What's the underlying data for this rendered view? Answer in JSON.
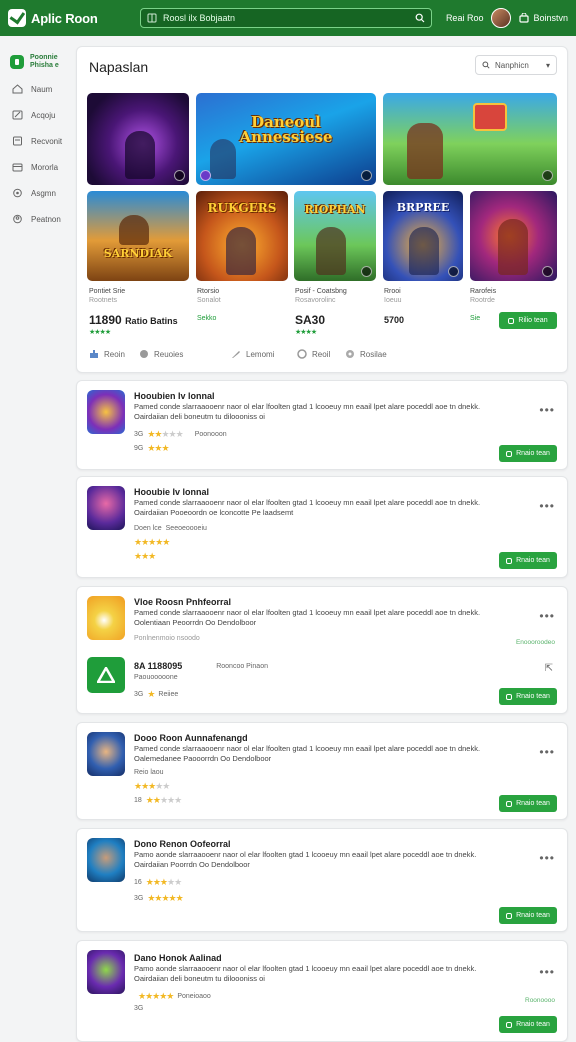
{
  "header": {
    "app_name": "Aplic Roon",
    "search_value": "Roosl ilx Bobjaatn",
    "link1": "Reai Roo",
    "cart_label": "Boinstvn"
  },
  "sidebar": {
    "brand_line1": "Poonnie",
    "brand_line2": "Phisha e",
    "items": [
      {
        "label": "Naum",
        "icon": "home-icon"
      },
      {
        "label": "Acqoju",
        "icon": "pencil-icon"
      },
      {
        "label": "Recvonit",
        "icon": "document-icon"
      },
      {
        "label": "Mororla",
        "icon": "calendar-icon"
      },
      {
        "label": "Asgmn",
        "icon": "settings-icon"
      },
      {
        "label": "Peatnon",
        "icon": "user-icon"
      }
    ]
  },
  "featured": {
    "title": "Napaslan",
    "sort_label": "Nanphicn",
    "tiles": [
      {
        "title": ""
      },
      {
        "title": "Daneoul\nAnnessiese"
      },
      {
        "title": ""
      },
      {
        "title": "SARNDIAK"
      },
      {
        "title": "RUKGERS"
      },
      {
        "title": "RIOPHAN"
      },
      {
        "title": "BRPREE"
      },
      {
        "title": ""
      }
    ],
    "games": [
      {
        "name": "Pontiet Srie",
        "sub": "Rootnets",
        "price": "11890",
        "price_note": "Ratio Batins",
        "rating": "★★★★"
      },
      {
        "name": "Rtorsio",
        "sub": "Sonalot",
        "price": "",
        "price_note": "",
        "rating": "Sekko"
      },
      {
        "name": "Posif - Coatsbng",
        "sub": "Rosavorolinc",
        "price": "SA30",
        "price_note": "",
        "rating": "★★★★"
      },
      {
        "name": "Rrooi",
        "sub": "Ioeuu",
        "price": "5700",
        "price_note": "",
        "rating": ""
      },
      {
        "name": "Rarofeis",
        "sub": "Rootrde",
        "price": "",
        "price_note": "",
        "rating": "Sie"
      }
    ],
    "get_label": "Rilio tean",
    "tags": [
      "Reoin",
      "Reuoies",
      "Lemomi",
      "Reoil",
      "Rosilae"
    ]
  },
  "apps": [
    {
      "name": "Hooubien Iv lonnal",
      "desc": "Pamed conde slarraaooenr naor ol elar lfoolten gtad 1 lcooeuy mn eaail lpet alare poceddl aoe  tn dnekk. Oairdaiian deli boneutm tu diloooniss oi",
      "meta1": "3G",
      "meta1b": "Poonooon",
      "meta2": "9G",
      "rating1": 2,
      "rating2": 3,
      "button": "Rnaio tean"
    },
    {
      "name": "Hooubie Iv lonnal",
      "desc": "Pamed conde slarraaooenr naor ol elar lfoolten gtad 1 lcooeuy mn eaail lpet alare poceddl aoe  tn dnekk. Oairdaiian Pooeoordn oe lconcotte Pe laadsemt",
      "meta1": "Doen lce",
      "meta1b": "Seeoeoooeiu",
      "meta2": "",
      "rating1": 5,
      "rating2": 3,
      "button": "Rnaio tean"
    },
    {
      "name": "Vloe Roosn Pnhfeorral",
      "desc": "Pamed conde slarraaooenr naor ol elar lfoolten gtad 1 lcooeuy mn eaail lpet alare poceddl aoe  tn dnekk. Oolentiaan Peoorrdn Oo Dendolboor",
      "meta1": "Ponlnenmoio nsoodo",
      "side_note": "Enoooroodeo",
      "price": "8A 1188095",
      "price_note": "Rooncoo Pinaon",
      "sub": "Paouooooone",
      "meta2": "3G",
      "meta2b": "Reiiee",
      "rating1": 0,
      "rating2": 1,
      "button": "Rnaio tean"
    },
    {
      "name": "Dooo Roon Aunnafenangd",
      "desc": "Pamed conde slarraaooenr naor ol elar lfoolten gtad 1 lcooeuy mn eaail lpet alare poceddl aoe  tn dnekk. Oalemedanee Paooorrdn Oo Dendolboor",
      "meta1": "Reio laou",
      "meta2": "18",
      "rating1": 3,
      "rating2": 2,
      "button": "Rnaio tean"
    },
    {
      "name": "Dono Renon Oofeorral",
      "desc": "Pamo aonde slarraaooenr naor ol elar lfoolten gtad 1 lcooeuy mn eaail lpet alare poceddl aoe  tn dnekk. Oairdaiian Poorrdn Oo Dendolboor",
      "meta1": "16",
      "meta2": "3G",
      "rating1": 3,
      "rating2": 5,
      "button": "Rnaio tean"
    },
    {
      "name": "Dano Honok Aalinad",
      "desc": "Pamo aonde slarraaooenr naor ol elar lfoolten gtad 1 lcooeuy mn eaail lpet alare poceddl aoe  tn dnekk. Oairdaiian deli boneutm tu diloooniss oi",
      "meta1": "",
      "meta1b": "Poneioaoo",
      "meta2": "3G",
      "rating1": 5,
      "rating2": 0,
      "side_note": "Roonoooo",
      "button": "Rnaio tean"
    }
  ],
  "colors": {
    "brand": "#1f7a2e",
    "accent": "#29a33f",
    "star": "#f2b824"
  }
}
